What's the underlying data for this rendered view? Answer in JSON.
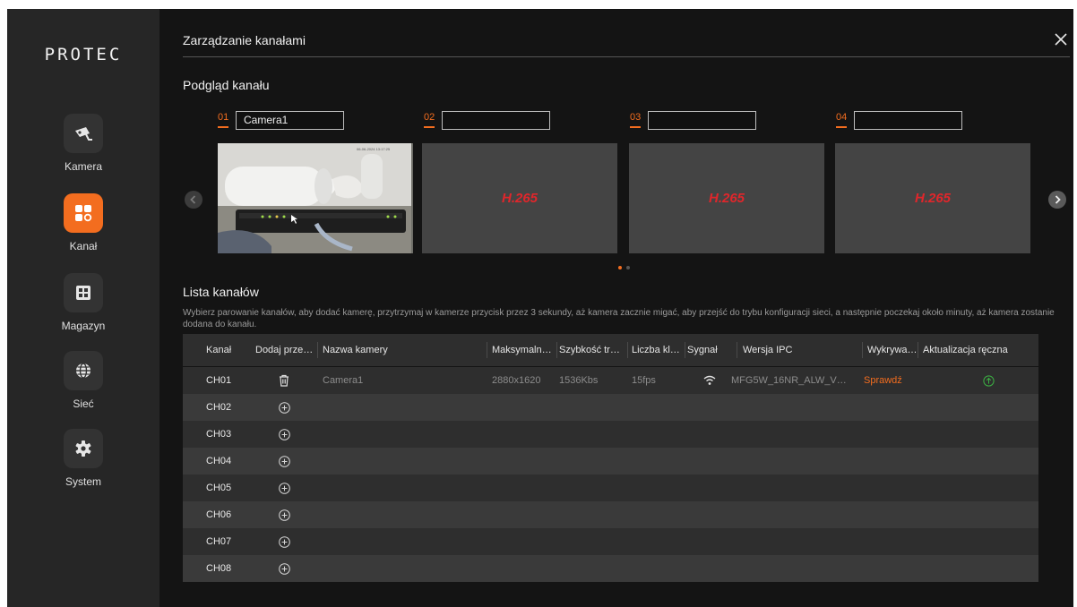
{
  "app": {
    "logo": "PROTEC"
  },
  "sidebar": {
    "items": [
      {
        "label": "Kamera",
        "icon": "camera-icon",
        "active": false
      },
      {
        "label": "Kanał",
        "icon": "channel-grid-icon",
        "active": true
      },
      {
        "label": "Magazyn",
        "icon": "storage-icon",
        "active": false
      },
      {
        "label": "Sieć",
        "icon": "globe-icon",
        "active": false
      },
      {
        "label": "System",
        "icon": "gear-icon",
        "active": false
      }
    ]
  },
  "header": {
    "title": "Zarządzanie kanałami",
    "close_icon": "close-icon"
  },
  "preview": {
    "title": "Podgląd kanału",
    "channels": [
      {
        "num": "01",
        "name": "Camera1"
      },
      {
        "num": "02",
        "name": ""
      },
      {
        "num": "03",
        "name": ""
      },
      {
        "num": "04",
        "name": ""
      }
    ],
    "codec_label": "H.265",
    "page_count": 2,
    "active_page": 1
  },
  "list": {
    "title": "Lista kanałów",
    "instructions": "Wybierz parowanie kanałów, aby dodać kamerę, przytrzymaj w kamerze przycisk przez 3 sekundy, aż kamera zacznie migać, aby przejść do trybu konfiguracji sieci, a następnie poczekaj około minuty, aż kamera zostanie dodana do kanału.",
    "columns": [
      "Kanał",
      "Dodaj prze…",
      "Nazwa kamery",
      "Maksymaln…",
      "Szybkość tr…",
      "Liczba kl…",
      "Sygnał",
      "Wersja IPC",
      "Wykrywa…",
      "Aktualizacja ręczna"
    ],
    "rows": [
      {
        "channel": "CH01",
        "action": "delete",
        "name": "Camera1",
        "resolution": "2880x1620",
        "bitrate": "1536Kbs",
        "fps": "15fps",
        "signal": "wifi",
        "version": "MFG5W_16NR_ALW_V…",
        "detect": "Sprawdź",
        "update": "upgrade"
      },
      {
        "channel": "CH02",
        "action": "add"
      },
      {
        "channel": "CH03",
        "action": "add"
      },
      {
        "channel": "CH04",
        "action": "add"
      },
      {
        "channel": "CH05",
        "action": "add"
      },
      {
        "channel": "CH06",
        "action": "add"
      },
      {
        "channel": "CH07",
        "action": "add"
      },
      {
        "channel": "CH08",
        "action": "add"
      }
    ]
  },
  "colors": {
    "accent": "#f36d1f",
    "codec": "#e0262b",
    "update": "#3cb043"
  }
}
